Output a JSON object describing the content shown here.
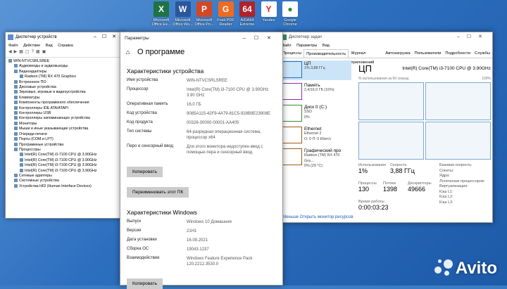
{
  "desktop": {
    "icons": [
      {
        "label": "Microsoft\nOffice Ex...",
        "color": "#1f7244",
        "glyph": "X"
      },
      {
        "label": "Microsoft\nOffice Wo...",
        "color": "#2b579a",
        "glyph": "W"
      },
      {
        "label": "Microsoft\nOffice Po...",
        "color": "#d24726",
        "glyph": "P"
      },
      {
        "label": "Foxit PDF\nReader",
        "color": "#ef6b1f",
        "glyph": "G"
      },
      {
        "label": "AIDA64\nExtreme",
        "color": "#b1222b",
        "glyph": "64"
      },
      {
        "label": "Yandex",
        "color": "#ffffff",
        "glyph": "Y"
      },
      {
        "label": "Google\nChrome",
        "color": "#ffffff",
        "glyph": "●"
      }
    ]
  },
  "device_manager": {
    "title": "Диспетчер устройств",
    "menu": [
      "Файл",
      "Действие",
      "Вид",
      "Справка"
    ],
    "tree": [
      {
        "t": "WIN-NTVCSRLSREE",
        "d": 0
      },
      {
        "t": "Аудиовходы и аудиовыходы",
        "d": 1
      },
      {
        "t": "Видеоадаптеры",
        "d": 1
      },
      {
        "t": "Radeon (TM) RX 470 Graphics",
        "d": 2
      },
      {
        "t": "Встроенное ПО",
        "d": 1
      },
      {
        "t": "Дисковые устройства",
        "d": 1
      },
      {
        "t": "Звуковые, игровые и видеоустройства",
        "d": 1
      },
      {
        "t": "Клавиатуры",
        "d": 1
      },
      {
        "t": "Компоненты программного обеспечения",
        "d": 1
      },
      {
        "t": "Контроллеры IDE ATA/ATAPI",
        "d": 1
      },
      {
        "t": "Контроллеры USB",
        "d": 1
      },
      {
        "t": "Контроллеры запоминающих устройства",
        "d": 1
      },
      {
        "t": "Мониторы",
        "d": 1
      },
      {
        "t": "Мыши и иные указывающие устройства",
        "d": 1
      },
      {
        "t": "Очереди печати",
        "d": 1
      },
      {
        "t": "Порты (COM и LPT)",
        "d": 1
      },
      {
        "t": "Программные устройства",
        "d": 1
      },
      {
        "t": "Процессоры",
        "d": 1
      },
      {
        "t": "Intel(R) Core(TM) i3-7100 CPU @ 3.90GHz",
        "d": 2
      },
      {
        "t": "Intel(R) Core(TM) i3-7100 CPU @ 3.90GHz",
        "d": 2
      },
      {
        "t": "Intel(R) Core(TM) i3-7100 CPU @ 3.90GHz",
        "d": 2
      },
      {
        "t": "Intel(R) Core(TM) i3-7100 CPU @ 3.90GHz",
        "d": 2
      },
      {
        "t": "Сетевые адаптеры",
        "d": 1
      },
      {
        "t": "Системные устройства",
        "d": 1
      },
      {
        "t": "Устройства HID (Human Interface Devices)",
        "d": 1
      }
    ]
  },
  "settings": {
    "window_title": "Параметры",
    "page_title": "О программе",
    "device_section": "Характеристики устройства",
    "device": [
      {
        "k": "Имя устройства",
        "v": "WIN-NTVCSRLSREE"
      },
      {
        "k": "Процессор",
        "v": "Intel(R) Core(TM) i3-7100 CPU @ 3.90GHz 3.90 GHz"
      },
      {
        "k": "Оперативная память",
        "v": "16,0 ГБ"
      },
      {
        "k": "Код устройства",
        "v": "9085A115-42F9-4A79-81C5-928B9E23908E"
      },
      {
        "k": "Код продукта",
        "v": "00326-30000-00001-AA405"
      },
      {
        "k": "Тип системы",
        "v": "64-разрядная операционная система, процессор x64"
      },
      {
        "k": "Перо и сенсорный ввод",
        "v": "Для этого монитора недоступен ввод с помощью пера и сенсорный ввод"
      }
    ],
    "copy_btn": "Копировать",
    "rename_btn": "Переименовать этот ПК",
    "win_section": "Характеристики Windows",
    "windows": [
      {
        "k": "Выпуск",
        "v": "Windows 10 Домашняя"
      },
      {
        "k": "Версия",
        "v": "21H1"
      },
      {
        "k": "Дата установки",
        "v": "16.09.2021"
      },
      {
        "k": "Сборка ОС",
        "v": "19043.1237"
      },
      {
        "k": "Взаимодействие",
        "v": "Windows Feature Experience Pack 120.2212.3530.0"
      }
    ],
    "copy_btn2": "Копировать"
  },
  "task_manager": {
    "title": "Диспетчер задач",
    "menu": [
      "Файл",
      "Параметры",
      "Вид"
    ],
    "tabs": [
      "Процессы",
      "Производительность",
      "Журнал приложений",
      "Автозагрузка",
      "Пользователи",
      "Подробности",
      "Службы"
    ],
    "side": [
      {
        "name": "ЦП",
        "sub": "1% 3,88 ГГц",
        "color": "#1a74c4"
      },
      {
        "name": "Память",
        "sub": "2,4/16,0 ГБ (15%)",
        "color": "#8b2fa8"
      },
      {
        "name": "Диск 0 (C:)",
        "sub": "SSD\n0%",
        "color": "#3c8a2e"
      },
      {
        "name": "Ethernet",
        "sub": "Ethernet 2\nО: 0 П: 0 Кбит/с",
        "color": "#a05a14"
      },
      {
        "name": "Графический про",
        "sub": "Radeon (TM) RX 470 Gra...\n0% (29 °C)",
        "color": "#a05a14"
      }
    ],
    "main_title": "ЦП",
    "cpu_name": "Intel(R) Core(TM) i3-7100 CPU @ 3.90GHz",
    "graph_caption": "% использования за 60 секунд",
    "graph_max": "100%",
    "stats": [
      {
        "k": "Использование",
        "v": "1%"
      },
      {
        "k": "Скорость",
        "v": "3,88 ГГц"
      },
      {
        "k": "Процессы",
        "v": "130"
      },
      {
        "k": "Потоки",
        "v": "1398"
      },
      {
        "k": "Дескрипторы",
        "v": "49666"
      },
      {
        "k": "Время работы",
        "v": "0:00:03:23"
      }
    ],
    "right_stats": [
      "Базовая скорость:",
      "Сокеты:",
      "Ядра:",
      "Логических процессоров:",
      "Виртуализация:",
      "Кэш L1:",
      "Кэш L2:",
      "Кэш L3:"
    ],
    "footer": "Меньше   Открыть монитор ресурсов"
  },
  "watermark": "Avito"
}
